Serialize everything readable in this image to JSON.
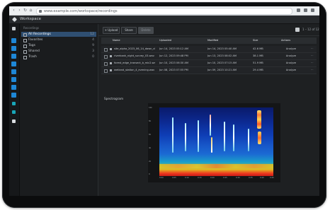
{
  "browser": {
    "url": "www.example.com/workspace/recordings"
  },
  "app": {
    "title": "Workspace"
  },
  "sidebar": {
    "heading": "Recordings",
    "items": [
      {
        "label": "All Recordings",
        "count": "12",
        "active": true
      },
      {
        "label": "Favorites",
        "count": "4",
        "active": false
      },
      {
        "label": "Tags",
        "count": "9",
        "active": false
      },
      {
        "label": "Shared",
        "count": "3",
        "active": false
      },
      {
        "label": "Trash",
        "count": "0",
        "active": false
      }
    ]
  },
  "toolbar": {
    "upload_label": "+ Upload",
    "share_label": "Share",
    "delete_label": "Delete",
    "pager_label": "1 – 12 of 12"
  },
  "table": {
    "columns": [
      "Name",
      "Uploaded",
      "Modified",
      "Size",
      "Actions"
    ],
    "rows": [
      {
        "name": "site_alpha_2023_06_14_dawn_chorus.wav",
        "uploaded": "Jun 14, 2023 05:12 AM",
        "modified": "Jun 14, 2023 05:40 AM",
        "size": "42.6 MB",
        "action": "Analyze"
      },
      {
        "name": "riverbank_night_survey_03.wav",
        "uploaded": "Jun 12, 2023 09:48 PM",
        "modified": "Jun 13, 2023 08:02 AM",
        "size": "38.1 MB",
        "action": "Analyze"
      },
      {
        "name": "forest_edge_transect_b_mic2.wav",
        "uploaded": "Jun 10, 2023 06:30 AM",
        "modified": "Jun 10, 2023 07:15 AM",
        "size": "51.9 MB",
        "action": "Analyze"
      },
      {
        "name": "wetland_station_4_evening.wav",
        "uploaded": "Jun 08, 2023 07:55 PM",
        "modified": "Jun 09, 2023 10:21 AM",
        "size": "29.4 MB",
        "action": "Analyze"
      }
    ]
  },
  "preview": {
    "label": "Spectrogram"
  },
  "spectrogram": {
    "y_ticks": [
      "10k",
      "8k",
      "6k",
      "4k",
      "2k",
      "0"
    ],
    "x_ticks": [
      "0:00",
      "0:05",
      "0:10",
      "0:15",
      "0:20",
      "0:25",
      "0:30",
      "0:35",
      "0:40",
      "0:45"
    ]
  },
  "colors": {
    "accent": "#2f4f72",
    "rail": [
      "#1e87d6",
      "#1e87d6",
      "#1e87d6",
      "#1e87d6",
      "#1e87d6",
      "#1e87d6",
      "#1e87d6",
      "#1e87d6",
      "#18a6b8",
      "#18a6b8",
      "#d9dde0"
    ]
  }
}
